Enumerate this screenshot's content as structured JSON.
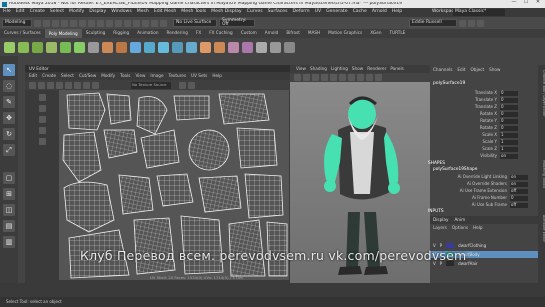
{
  "window": {
    "title": "Autodesk Maya 2018 - Not for Resale: E:\\_EXERCISE_FILES\\UV Mapping Game Characters in Maya\\UV Mapping Game Characters in Maya\\scenes\\ch5-07.ma* --- polySurface19",
    "controls": [
      "—",
      "☐",
      "✕"
    ]
  },
  "menubar": [
    "File",
    "Edit",
    "Create",
    "Select",
    "Modify",
    "Display",
    "Windows",
    "Mesh",
    "Edit Mesh",
    "Mesh Tools",
    "Mesh Display",
    "Curves",
    "Surfaces",
    "Deform",
    "UV",
    "Generate",
    "Cache",
    "Arnold",
    "Help"
  ],
  "workspace": {
    "label": "Workspace:",
    "value": "Maya Classic*"
  },
  "statusline": {
    "mode": "Modeling",
    "no_live": "No Live Surface",
    "symmetry": "Symmetry: Off",
    "user": "Eddie Russell"
  },
  "shelf_tabs": [
    "Curves / Surfaces",
    "Poly Modeling",
    "Sculpting",
    "Rigging",
    "Animation",
    "Rendering",
    "FX",
    "FX Caching",
    "Custom",
    "Arnold",
    "Bifrost",
    "MASH",
    "Motion Graphics",
    "XGen",
    "TURTLE"
  ],
  "shelf_active": "Poly Modeling",
  "uv_editor": {
    "title": "UV Editor",
    "menu": [
      "Edit",
      "Create",
      "Select",
      "Cut/Sew",
      "Modify",
      "Tools",
      "View",
      "Image",
      "Textures",
      "UV Sets",
      "Help"
    ],
    "texture_label": "No Texture Source",
    "status": "UV Shell: 20  Faces: 1534(0)  UVs: 1714(0) / 3 Uvs"
  },
  "viewport": {
    "menu": [
      "View",
      "Shading",
      "Lighting",
      "Show",
      "Renderer",
      "Panels"
    ]
  },
  "channel_box": {
    "menu": [
      "Channels",
      "Edit",
      "Object",
      "Show"
    ],
    "object": "polySurface19",
    "attributes": [
      {
        "name": "Translate X",
        "value": "0"
      },
      {
        "name": "Translate Y",
        "value": "0"
      },
      {
        "name": "Translate Z",
        "value": "0"
      },
      {
        "name": "Rotate X",
        "value": "0"
      },
      {
        "name": "Rotate Y",
        "value": "0"
      },
      {
        "name": "Rotate Z",
        "value": "0"
      },
      {
        "name": "Scale X",
        "value": "1"
      },
      {
        "name": "Scale Y",
        "value": "1"
      },
      {
        "name": "Scale Z",
        "value": "1"
      },
      {
        "name": "Visibility",
        "value": "on"
      }
    ],
    "shapes_header": "SHAPES",
    "shape_name": "polySurface19Shape",
    "shape_attrs": [
      {
        "name": "Ai Override Light Linking",
        "value": "on"
      },
      {
        "name": "Ai Override Shaders",
        "value": "on"
      },
      {
        "name": "Ai Use Frame Extension",
        "value": "off"
      },
      {
        "name": "Ai Frame Number",
        "value": "0"
      },
      {
        "name": "Ai Use Sub Frame",
        "value": "off"
      }
    ],
    "inputs_header": "INPUTS"
  },
  "side_tabs": [
    "Channel Box / Layer Editor",
    "Modeling Toolkit",
    "Attribute Editor"
  ],
  "layers": {
    "tabs": [
      "Display",
      "Anim"
    ],
    "menu": [
      "Layers",
      "Options",
      "Help"
    ],
    "rows": [
      {
        "v": "V",
        "p": "P",
        "name": "dwarfClothing",
        "color": "#3a3a9a"
      },
      {
        "v": "V",
        "p": "P",
        "name": "dwarfBody",
        "color": "#2a9a9a"
      },
      {
        "v": "V",
        "p": "P",
        "name": "dwarfHair",
        "color": "#2a2a2a"
      }
    ]
  },
  "helpline": "Select Tool: select an object",
  "watermark": "Клуб Перевод всем.  perevodvsem.ru    vk.com/perevodvsem",
  "colors": {
    "accent": "#5d8fbf",
    "body_teal": "#47e0b0"
  }
}
